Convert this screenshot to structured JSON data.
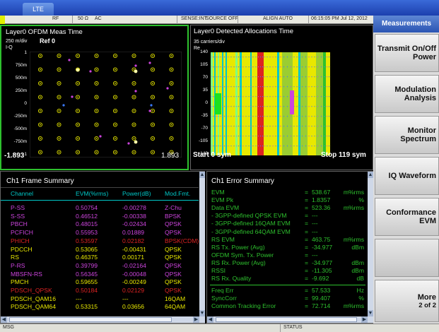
{
  "app": {
    "tab": "LTE"
  },
  "status": {
    "led": "RF",
    "rf": "RF",
    "impedance": "50 Ω",
    "coupling": "AC",
    "sense": "SENSE:INT",
    "source": "SOURCE OFF",
    "align": "ALIGN AUTO",
    "datetime": "06:15:05 PM Jul 12, 2012"
  },
  "meas_time": {
    "title": "Layer0 OFDM Meas Time",
    "scale": "250 m/div",
    "ref": "Ref 0",
    "axis_name": "I-Q",
    "y_ticks": [
      "1",
      "750m",
      "500m",
      "250m",
      "0",
      "-250m",
      "-500m",
      "-750m",
      "-1"
    ],
    "x_left": "-1.893",
    "x_right": "1.893"
  },
  "alloc_time": {
    "title": "Layer0 Detected Allocations Time",
    "scale": "35 carriers/div",
    "axis_name": "Re",
    "y_ticks": [
      "140",
      "105",
      "70",
      "35",
      "0",
      "-35",
      "-70",
      "-105",
      "-140"
    ],
    "x_left": "Start 0 sym",
    "x_right": "Stop 119 sym"
  },
  "frame_summary": {
    "title": "Ch1 Frame Summary",
    "headers": [
      "Channel",
      "EVM(%rms)",
      "Power(dB)",
      "Mod.Fmt."
    ],
    "rows": [
      {
        "ch": "P-SS",
        "evm": "0.50754",
        "pwr": "-0.00278",
        "mod": "Z-Chu",
        "color": "#cc44dd"
      },
      {
        "ch": "S-SS",
        "evm": "0.46512",
        "pwr": "-0.00338",
        "mod": "BPSK",
        "color": "#cc44dd"
      },
      {
        "ch": "PBCH",
        "evm": "0.48015",
        "pwr": "-0.02434",
        "mod": "QPSK",
        "color": "#cc44dd"
      },
      {
        "ch": "PCFICH",
        "evm": "0.55953",
        "pwr": "0.01889",
        "mod": "QPSK",
        "color": "#cc44dd"
      },
      {
        "ch": "PHICH",
        "evm": "0.53597",
        "pwr": "0.02182",
        "mod": "BPSK(CDM)",
        "color": "#dd2222"
      },
      {
        "ch": "PDCCH",
        "evm": "0.53065",
        "pwr": "-0.00431",
        "mod": "QPSK",
        "color": "#e8e800"
      },
      {
        "ch": "RS",
        "evm": "0.46375",
        "pwr": "0.00171",
        "mod": "QPSK",
        "color": "#e8e800"
      },
      {
        "ch": "P-RS",
        "evm": "0.39799",
        "pwr": "-0.02164",
        "mod": "QPSK",
        "color": "#cc44dd"
      },
      {
        "ch": "MBSFN-RS",
        "evm": "0.56345",
        "pwr": "-0.00048",
        "mod": "QPSK",
        "color": "#cc44dd"
      },
      {
        "ch": "PMCH",
        "evm": "0.59655",
        "pwr": "-0.00249",
        "mod": "QPSK",
        "color": "#e8e800"
      },
      {
        "ch": "PDSCH_QPSK",
        "evm": "0.50184",
        "pwr": "0.02129",
        "mod": "QPSK",
        "color": "#dd2222"
      },
      {
        "ch": "PDSCH_QAM16",
        "evm": "---",
        "pwr": "---",
        "mod": "16QAM",
        "color": "#e8e800"
      },
      {
        "ch": "PDSCH_QAM64",
        "evm": "0.53315",
        "pwr": "0.03656",
        "mod": "64QAM",
        "color": "#e8e800"
      }
    ]
  },
  "error_summary": {
    "title": "Ch1 Error Summary",
    "rows": [
      {
        "label": "EVM",
        "value": "538.67",
        "unit": "m%rms"
      },
      {
        "label": "EVM Pk",
        "value": "1.8357",
        "unit": "%"
      },
      {
        "label": "Data EVM",
        "value": "523.36",
        "unit": "m%rms"
      },
      {
        "label": " - 3GPP-defined QPSK EVM",
        "value": "---",
        "unit": ""
      },
      {
        "label": " - 3GPP-defined 16QAM EVM",
        "value": "---",
        "unit": ""
      },
      {
        "label": " - 3GPP-defined 64QAM EVM",
        "value": "---",
        "unit": ""
      },
      {
        "label": "RS EVM",
        "value": "463.75",
        "unit": "m%rms"
      },
      {
        "label": "RS Tx. Power (Avg)",
        "value": "-34.977",
        "unit": "dBm"
      },
      {
        "label": "OFDM Sym. Tx. Power",
        "value": "---",
        "unit": ""
      },
      {
        "label": "RS Rx. Power (Avg)",
        "value": "-34.977",
        "unit": "dBm"
      },
      {
        "label": "RSSI",
        "value": "-11.305",
        "unit": "dBm"
      },
      {
        "label": "RS Rx. Quality",
        "value": "-9.692",
        "unit": "dB"
      },
      {
        "label": "Freq Err",
        "value": "57.533",
        "unit": "Hz"
      },
      {
        "label": "SyncCorr",
        "value": "99.407",
        "unit": "%"
      },
      {
        "label": "Common Tracking Error",
        "value": "72.714",
        "unit": "m%rms"
      }
    ]
  },
  "softkeys": {
    "header": "Measurements",
    "keys": [
      {
        "line1": "Transmit On/Off",
        "line2": "Power"
      },
      {
        "line1": "Modulation",
        "line2": "Analysis"
      },
      {
        "line1": "Monitor",
        "line2": "Spectrum"
      },
      {
        "line1": "IQ Waveform",
        "line2": ""
      },
      {
        "line1": "Conformance",
        "line2": "EVM"
      },
      {
        "line1": "More",
        "line2": "2 of 2"
      }
    ]
  },
  "bottom": {
    "msg": "MSG",
    "status": "STATUS"
  },
  "colors": {
    "yellow": "#e8e800",
    "magenta": "#cc44dd",
    "red": "#dd2222",
    "green": "#2ec12e",
    "cyan": "#00c8c8"
  }
}
